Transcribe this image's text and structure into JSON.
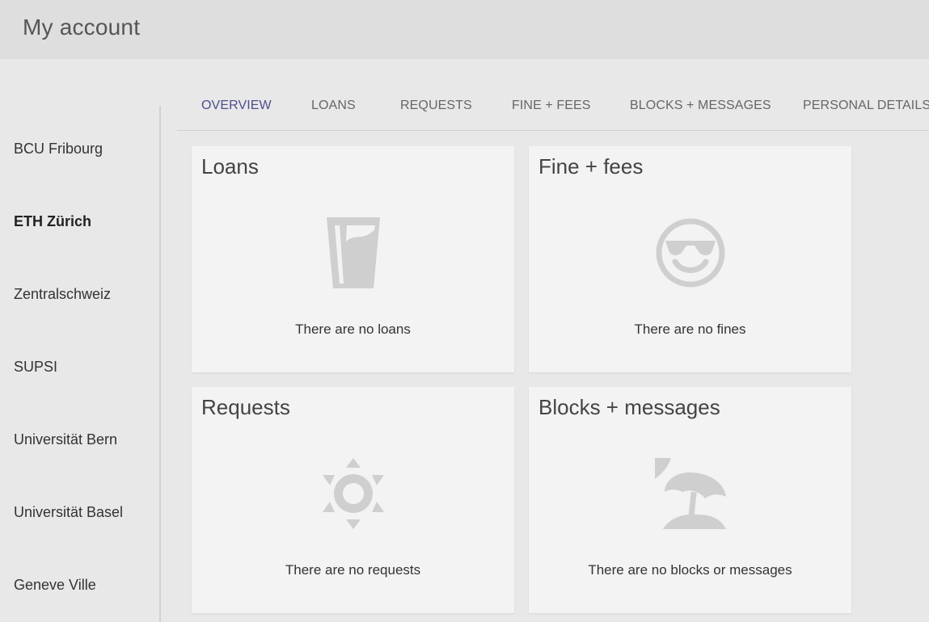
{
  "header": {
    "title": "My account"
  },
  "sidebar": {
    "items": [
      {
        "label": "BCU Fribourg",
        "active": false
      },
      {
        "label": "ETH Zürich",
        "active": true
      },
      {
        "label": "Zentralschweiz",
        "active": false
      },
      {
        "label": "SUPSI",
        "active": false
      },
      {
        "label": "Universität Bern",
        "active": false
      },
      {
        "label": "Universität Basel",
        "active": false
      },
      {
        "label": "Geneve Ville",
        "active": false
      }
    ]
  },
  "tabs": [
    {
      "label": "OVERVIEW",
      "active": true
    },
    {
      "label": "LOANS",
      "active": false
    },
    {
      "label": "REQUESTS",
      "active": false
    },
    {
      "label": "FINE + FEES",
      "active": false
    },
    {
      "label": "BLOCKS + MESSAGES",
      "active": false
    },
    {
      "label": "PERSONAL DETAILS",
      "active": false
    }
  ],
  "cards": {
    "loans": {
      "title": "Loans",
      "text": "There are no loans",
      "icon": "glass-icon"
    },
    "fines": {
      "title": "Fine + fees",
      "text": "There are no fines",
      "icon": "sunglasses-smiley-icon"
    },
    "requests": {
      "title": "Requests",
      "text": "There are no requests",
      "icon": "sun-icon"
    },
    "blocks": {
      "title": "Blocks + messages",
      "text": "There are no blocks or messages",
      "icon": "beach-umbrella-icon"
    }
  },
  "colors": {
    "accent": "#4e4e8e",
    "icon": "#cfcfcf",
    "card_bg": "#f3f3f3",
    "header_bg": "#dedede",
    "page_bg": "#e8e8e8"
  }
}
